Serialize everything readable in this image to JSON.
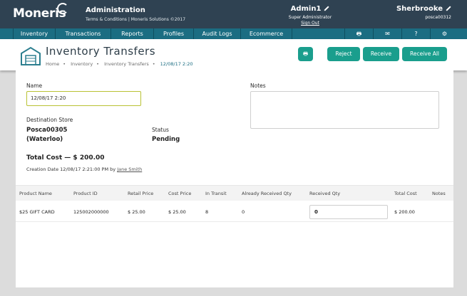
{
  "topbar": {
    "logo": "Moneris",
    "app_title": "Administration",
    "subtitle": "Terms & Conditions | Moneris Solutions ©2017",
    "user_name": "Admin1",
    "user_role": "Super Administrator",
    "sign_out": "Sign Out",
    "store_name": "Sherbrooke",
    "store_id": "posca00312"
  },
  "nav": {
    "items": [
      "Inventory",
      "Transactions",
      "Reports",
      "Profiles",
      "Audit Logs",
      "Ecommerce"
    ],
    "icons": [
      "printer-icon",
      "mail-icon",
      "help-icon",
      "settings-icon"
    ],
    "icon_glyphs": [
      "🖶",
      "✉",
      "?",
      "⚙"
    ]
  },
  "header": {
    "title": "Inventory Transfers",
    "breadcrumb": [
      "Home",
      "Inventory",
      "Inventory Transfers",
      "12/08/17 2:20"
    ],
    "buttons": {
      "print": "🖶",
      "reject": "Reject",
      "receive": "Receive",
      "receive_all": "Receive All"
    }
  },
  "form": {
    "name_label": "Name",
    "name_value": "12/08/17 2:20",
    "notes_label": "Notes",
    "destination_label": "Destination Store",
    "destination_line1": "Posca00305",
    "destination_line2": "(Waterloo)",
    "status_label": "Status",
    "status_value": "Pending",
    "total_cost": "Total Cost — $ 200.00",
    "created_prefix": "Creation Date 12/08/17 2:21:00 PM by",
    "created_by": "Jane Smith"
  },
  "table": {
    "columns": [
      "Product Name",
      "Product ID",
      "Retail Price",
      "Cost Price",
      "In Transit",
      "Already Received Qty",
      "Received Qty",
      "Total Cost",
      "Notes"
    ],
    "rows": [
      {
        "product_name": "$25 GIFT CARD",
        "product_id": "125002000000",
        "retail_price": "$ 25.00",
        "cost_price": "$ 25.00",
        "in_transit": "8",
        "already_received": "0",
        "received_qty": "0",
        "total_cost": "$ 200.00",
        "notes": ""
      }
    ]
  },
  "colors": {
    "topbar": "#2f4252",
    "nav": "#1b6d82",
    "accent_button": "#1a9e8d",
    "input_focus_border": "#b9c234"
  }
}
